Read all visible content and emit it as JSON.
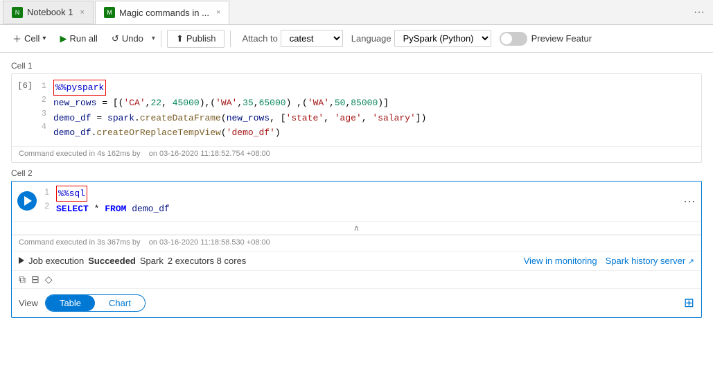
{
  "tabs": [
    {
      "id": "tab1",
      "label": "Notebook 1",
      "active": false,
      "icon": "N"
    },
    {
      "id": "tab2",
      "label": "Magic commands in ...",
      "active": true,
      "icon": "M"
    }
  ],
  "toolbar": {
    "cell_label": "Cell",
    "run_all_label": "Run all",
    "undo_label": "Undo",
    "publish_label": "Publish",
    "attach_label": "Attach to",
    "attach_value": "catest",
    "language_label": "Language",
    "language_value": "PySpark (Python)",
    "preview_label": "Preview Featur"
  },
  "cell1": {
    "label": "Cell 1",
    "exec_num": "[6]",
    "lines": [
      {
        "num": "1",
        "content": "%%pyspark",
        "magic": true
      },
      {
        "num": "2",
        "content": "new_rows = [('CA',22, 45000),('WA',35,65000) ,('WA',50,85000)]"
      },
      {
        "num": "3",
        "content": "demo_df = spark.createDataFrame(new_rows, ['state', 'age', 'salary'])"
      },
      {
        "num": "4",
        "content": "demo_df.createOrReplaceTempView('demo_df')"
      }
    ],
    "footer": "Command executed in 4s 162ms by",
    "footer2": "on 03-16-2020 11:18:52.754 +08:00"
  },
  "cell2": {
    "label": "Cell 2",
    "lines": [
      {
        "num": "1",
        "content": "%%sql",
        "magic": true
      },
      {
        "num": "2",
        "content": "SELECT * FROM demo_df"
      }
    ],
    "footer": "Command executed in 3s 367ms by",
    "footer2": "on 03-16-2020 11:18:58.530 +08:00",
    "job_text": "Job execution",
    "job_status": "Succeeded",
    "job_spark": "Spark",
    "job_executors": "2 executors 8 cores",
    "view_monitoring": "View in monitoring",
    "spark_history": "Spark history server",
    "view_label": "View",
    "table_btn": "Table",
    "chart_btn": "Chart"
  }
}
